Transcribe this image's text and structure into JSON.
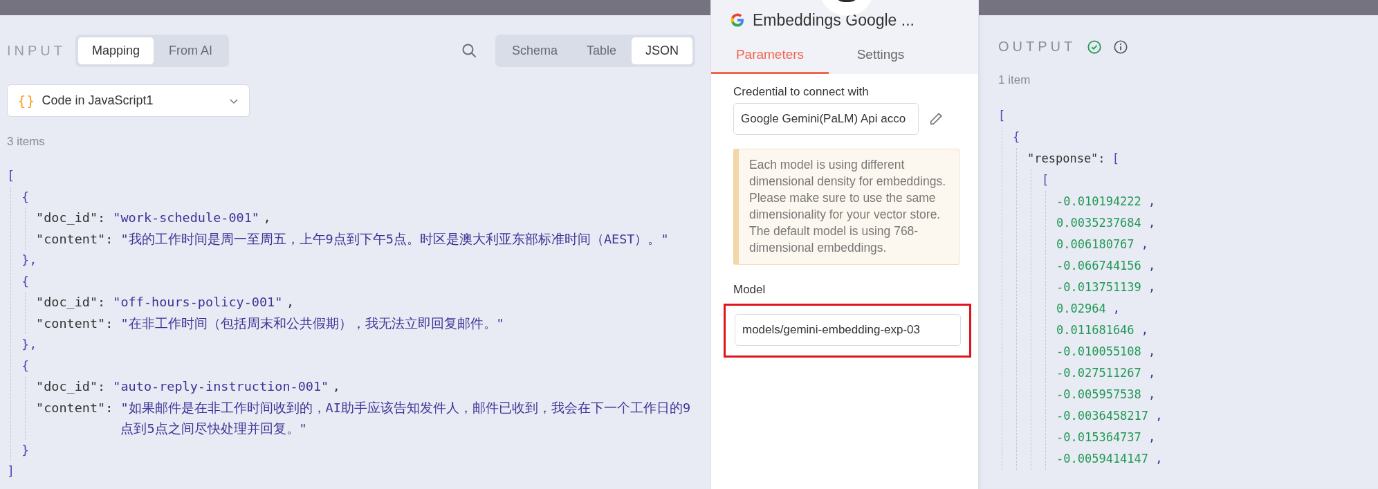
{
  "input": {
    "title": "INPUT",
    "modes": [
      {
        "label": "Mapping",
        "selected": true
      },
      {
        "label": "From AI",
        "selected": false
      }
    ],
    "views": [
      {
        "label": "Schema",
        "selected": false
      },
      {
        "label": "Table",
        "selected": false
      },
      {
        "label": "JSON",
        "selected": true
      }
    ],
    "source": {
      "icon": "{}",
      "label": "Code in JavaScript1"
    },
    "count": "3 items",
    "json": {
      "kind": "block",
      "open": "[",
      "close": "]",
      "children": [
        {
          "kind": "block",
          "open": "{",
          "close": "},",
          "children": [
            {
              "kind": "field",
              "key": "\"doc_id\":",
              "value": "\"work-schedule-001\"",
              "comma": ","
            },
            {
              "kind": "field",
              "key": "\"content\":",
              "value": "\"我的工作时间是周一至周五，上午9点到下午5点。时区是澳大利亚东部标准时间（AEST）。\""
            }
          ]
        },
        {
          "kind": "block",
          "open": "{",
          "close": "},",
          "children": [
            {
              "kind": "field",
              "key": "\"doc_id\":",
              "value": "\"off-hours-policy-001\"",
              "comma": ","
            },
            {
              "kind": "field",
              "key": "\"content\":",
              "value": "\"在非工作时间（包括周末和公共假期），我无法立即回复邮件。\""
            }
          ]
        },
        {
          "kind": "block",
          "open": "{",
          "close": "}",
          "children": [
            {
              "kind": "field",
              "key": "\"doc_id\":",
              "value": "\"auto-reply-instruction-001\"",
              "comma": ","
            },
            {
              "kind": "field",
              "key": "\"content\":",
              "value": "\"如果邮件是在非工作时间收到的，AI助手应该告知发件人，邮件已收到，我会在下一个工作日的9点到5点之间尽快处理并回复。\""
            }
          ]
        }
      ]
    }
  },
  "node": {
    "title": "Embeddings Google ...",
    "tabs": [
      {
        "label": "Parameters",
        "selected": true
      },
      {
        "label": "Settings",
        "selected": false
      }
    ],
    "credential": {
      "label": "Credential to connect with",
      "value": "Google Gemini(PaLM) Api acco"
    },
    "notice": "Each model is using different dimensional density for embeddings. Please make sure to use the same dimensionality for your vector store. The default model is using 768-dimensional embeddings.",
    "model": {
      "label": "Model",
      "value": "models/gemini-embedding-exp-03",
      "highlighted": true
    }
  },
  "output": {
    "title": "OUTPUT",
    "success": true,
    "count": "1 item",
    "json": {
      "kind": "block",
      "open": "[",
      "children": [
        {
          "kind": "block",
          "open": "{",
          "children": [
            {
              "kind": "block",
              "key": "\"response\":",
              "open": "[",
              "children": [
                {
                  "kind": "block",
                  "open": "[",
                  "children": [
                    {
                      "kind": "number",
                      "value": "-0.010194222",
                      "comma": ","
                    },
                    {
                      "kind": "number",
                      "value": "0.0035237684",
                      "comma": ","
                    },
                    {
                      "kind": "number",
                      "value": "0.006180767",
                      "comma": ","
                    },
                    {
                      "kind": "number",
                      "value": "-0.066744156",
                      "comma": ","
                    },
                    {
                      "kind": "number",
                      "value": "-0.013751139",
                      "comma": ","
                    },
                    {
                      "kind": "number",
                      "value": "0.02964",
                      "comma": ","
                    },
                    {
                      "kind": "number",
                      "value": "0.011681646",
                      "comma": ","
                    },
                    {
                      "kind": "number",
                      "value": "-0.010055108",
                      "comma": ","
                    },
                    {
                      "kind": "number",
                      "value": "-0.027511267",
                      "comma": ","
                    },
                    {
                      "kind": "number",
                      "value": "-0.005957538",
                      "comma": ","
                    },
                    {
                      "kind": "number",
                      "value": "-0.0036458217",
                      "comma": ","
                    },
                    {
                      "kind": "number",
                      "value": "-0.015364737",
                      "comma": ","
                    },
                    {
                      "kind": "number",
                      "value": "-0.0059414147",
                      "comma": ","
                    }
                  ]
                }
              ]
            }
          ]
        }
      ]
    }
  }
}
